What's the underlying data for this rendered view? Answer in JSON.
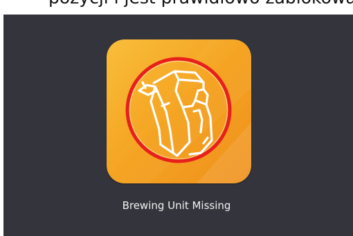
{
  "top_caption": "pozycji i jest prawidłowo zablokowany.",
  "alert": {
    "icon": "brewing-unit-missing-icon",
    "label": "Brewing Unit Missing"
  },
  "colors": {
    "screen_background": "#34343c",
    "tile_orange": "#f5a623",
    "ring_red": "#e8201c",
    "icon_line": "#ffffff",
    "label_text": "#f2f2f2"
  }
}
